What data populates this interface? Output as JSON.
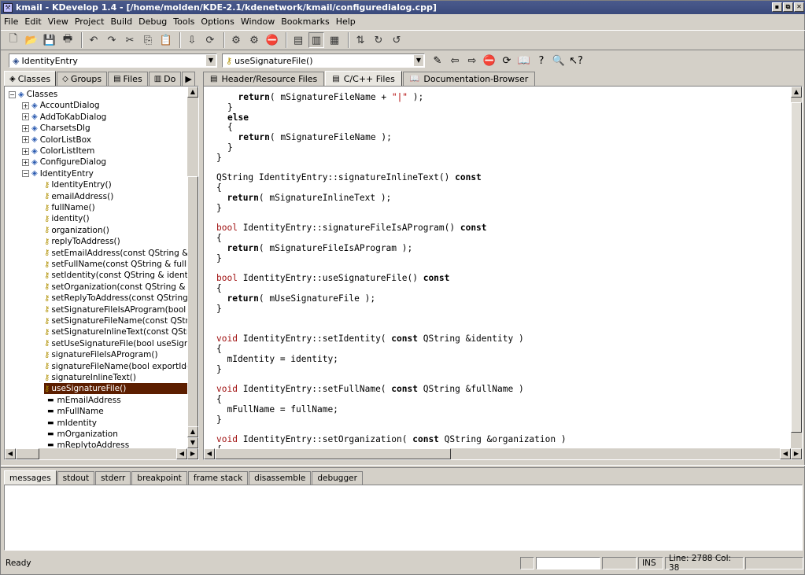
{
  "window": {
    "title": "kmail - KDevelop 1.4 - [/home/molden/KDE-2.1/kdenetwork/kmail/configuredialog.cpp]",
    "buttons": [
      "▪",
      "⧉",
      "✕"
    ]
  },
  "menu": [
    "File",
    "Edit",
    "View",
    "Project",
    "Build",
    "Debug",
    "Tools",
    "Options",
    "Window",
    "Bookmarks",
    "Help"
  ],
  "toolbar": {
    "icons": [
      "new-file-icon",
      "open-file-icon",
      "save-icon",
      "print-icon",
      "sep",
      "undo-icon",
      "redo-icon",
      "cut-icon",
      "copy-icon",
      "paste-icon",
      "sep",
      "compile-icon",
      "make-icon",
      "sep",
      "build-icon",
      "rebuild-icon",
      "stop-icon",
      "sep",
      "view-tree-icon",
      "view-output-icon",
      "view-tabs-icon",
      "sep",
      "debug-step-icon",
      "debug-next-icon",
      "debug-out-icon"
    ],
    "glyphs": [
      "🗋",
      "📂",
      "💾",
      "🖶",
      "",
      "↶",
      "↷",
      "✂",
      "⎘",
      "📋",
      "",
      "⇩",
      "⟳",
      "",
      "⚙",
      "⚙",
      "⛔",
      "",
      "▤",
      "▥",
      "▦",
      "",
      "⇅",
      "↻",
      "↺"
    ]
  },
  "toolbar2": {
    "class_combo": "IdentityEntry",
    "method_combo": "useSignatureFile()",
    "icons": [
      "wand-icon",
      "back-icon",
      "forward-icon",
      "stop-search-icon",
      "reload-icon",
      "book-icon",
      "help-icon",
      "search-icon",
      "whats-this-icon"
    ],
    "glyphs": [
      "✎",
      "⇦",
      "⇨",
      "⛔",
      "⟳",
      "📖",
      "?",
      "🔍",
      "↖?"
    ]
  },
  "left_tabs": [
    {
      "label": "Classes",
      "icon": "classes-tab-icon",
      "glyph": "◈"
    },
    {
      "label": "Groups",
      "icon": "groups-tab-icon",
      "glyph": "◇"
    },
    {
      "label": "Files",
      "icon": "files-tab-icon",
      "glyph": "▤"
    },
    {
      "label": "Do",
      "icon": "docs-tab-icon",
      "glyph": "▥"
    }
  ],
  "tree": {
    "root": "Classes",
    "classes": [
      "AccountDialog",
      "AddToKabDialog",
      "CharsetsDlg",
      "ColorListBox",
      "ColorListItem",
      "ConfigureDialog",
      "IdentityEntry"
    ],
    "members": [
      "IdentityEntry()",
      "emailAddress()",
      "fullName()",
      "identity()",
      "organization()",
      "replyToAddress()",
      "setEmailAddress(const QString & ema",
      "setFullName(const QString & fullName",
      "setIdentity(const QString & identity)",
      "setOrganization(const QString & orga",
      "setReplyToAddress(const QString & r",
      "setSignatureFileIsAProgram(bool sign",
      "setSignatureFileName(const QString &",
      "setSignatureInlineText(const QString &",
      "setUseSignatureFile(bool useSignatur",
      "signatureFileIsAProgram()",
      "signatureFileName(bool exportIdentity",
      "signatureInlineText()",
      "useSignatureFile()"
    ],
    "attributes": [
      "mEmailAddress",
      "mFullName",
      "mIdentity",
      "mOrganization",
      "mReplytoAddress"
    ],
    "selected": "useSignatureFile()"
  },
  "right_tabs": [
    {
      "label": "Header/Resource Files",
      "icon": "header-files-icon",
      "glyph": "▤"
    },
    {
      "label": "C/C++ Files",
      "icon": "cpp-files-icon",
      "glyph": "▤"
    },
    {
      "label": "Documentation-Browser",
      "icon": "doc-browser-icon",
      "glyph": "📖"
    }
  ],
  "code": [
    [
      [
        "  ",
        ""
      ],
      [
        "return",
        "kw"
      ],
      [
        "( mSignatureFileName + ",
        ""
      ],
      [
        "\"|\"",
        "st"
      ],
      [
        " );",
        ""
      ]
    ],
    [
      [
        "}",
        ""
      ]
    ],
    [
      [
        "else",
        "kw"
      ]
    ],
    [
      [
        "{",
        ""
      ]
    ],
    [
      [
        "  ",
        ""
      ],
      [
        "return",
        "kw"
      ],
      [
        "( mSignatureFileName );",
        ""
      ]
    ],
    [
      [
        "}",
        ""
      ]
    ],
    [
      [
        "}",
        ""
      ]
    ],
    [
      [
        "",
        ""
      ]
    ],
    [
      [
        "QString IdentityEntry::signatureInlineText() ",
        ""
      ],
      [
        "const",
        "kw"
      ]
    ],
    [
      [
        "{",
        ""
      ]
    ],
    [
      [
        "  ",
        ""
      ],
      [
        "return",
        "kw"
      ],
      [
        "( mSignatureInlineText );",
        ""
      ]
    ],
    [
      [
        "}",
        ""
      ]
    ],
    [
      [
        "",
        ""
      ]
    ],
    [
      [
        "bool",
        "ty"
      ],
      [
        " IdentityEntry::signatureFileIsAProgram() ",
        ""
      ],
      [
        "const",
        "kw"
      ]
    ],
    [
      [
        "{",
        ""
      ]
    ],
    [
      [
        "  ",
        ""
      ],
      [
        "return",
        "kw"
      ],
      [
        "( mSignatureFileIsAProgram );",
        ""
      ]
    ],
    [
      [
        "}",
        ""
      ]
    ],
    [
      [
        "",
        ""
      ]
    ],
    [
      [
        "bool",
        "ty"
      ],
      [
        " IdentityEntry::useSignatureFile() ",
        ""
      ],
      [
        "const",
        "kw"
      ]
    ],
    [
      [
        "{",
        ""
      ]
    ],
    [
      [
        "  ",
        ""
      ],
      [
        "return",
        "kw"
      ],
      [
        "( mUseSignatureFile );",
        ""
      ]
    ],
    [
      [
        "}",
        ""
      ]
    ],
    [
      [
        "",
        ""
      ]
    ],
    [
      [
        "",
        ""
      ]
    ],
    [
      [
        "void",
        "ty"
      ],
      [
        " IdentityEntry::setIdentity( ",
        ""
      ],
      [
        "const",
        "kw"
      ],
      [
        " QString &identity )",
        ""
      ]
    ],
    [
      [
        "{",
        ""
      ]
    ],
    [
      [
        "  mIdentity = identity;",
        ""
      ]
    ],
    [
      [
        "}",
        ""
      ]
    ],
    [
      [
        "",
        ""
      ]
    ],
    [
      [
        "void",
        "ty"
      ],
      [
        " IdentityEntry::setFullName( ",
        ""
      ],
      [
        "const",
        "kw"
      ],
      [
        " QString &fullName )",
        ""
      ]
    ],
    [
      [
        "{",
        ""
      ]
    ],
    [
      [
        "  mFullName = fullName;",
        ""
      ]
    ],
    [
      [
        "}",
        ""
      ]
    ],
    [
      [
        "",
        ""
      ]
    ],
    [
      [
        "void",
        "ty"
      ],
      [
        " IdentityEntry::setOrganization( ",
        ""
      ],
      [
        "const",
        "kw"
      ],
      [
        " QString &organization )",
        ""
      ]
    ],
    [
      [
        "{",
        ""
      ]
    ]
  ],
  "bottom_tabs": [
    "messages",
    "stdout",
    "stderr",
    "breakpoint",
    "frame stack",
    "disassemble",
    "debugger"
  ],
  "status": {
    "ready": "Ready",
    "ins": "INS",
    "position": "Line: 2788 Col: 38"
  }
}
